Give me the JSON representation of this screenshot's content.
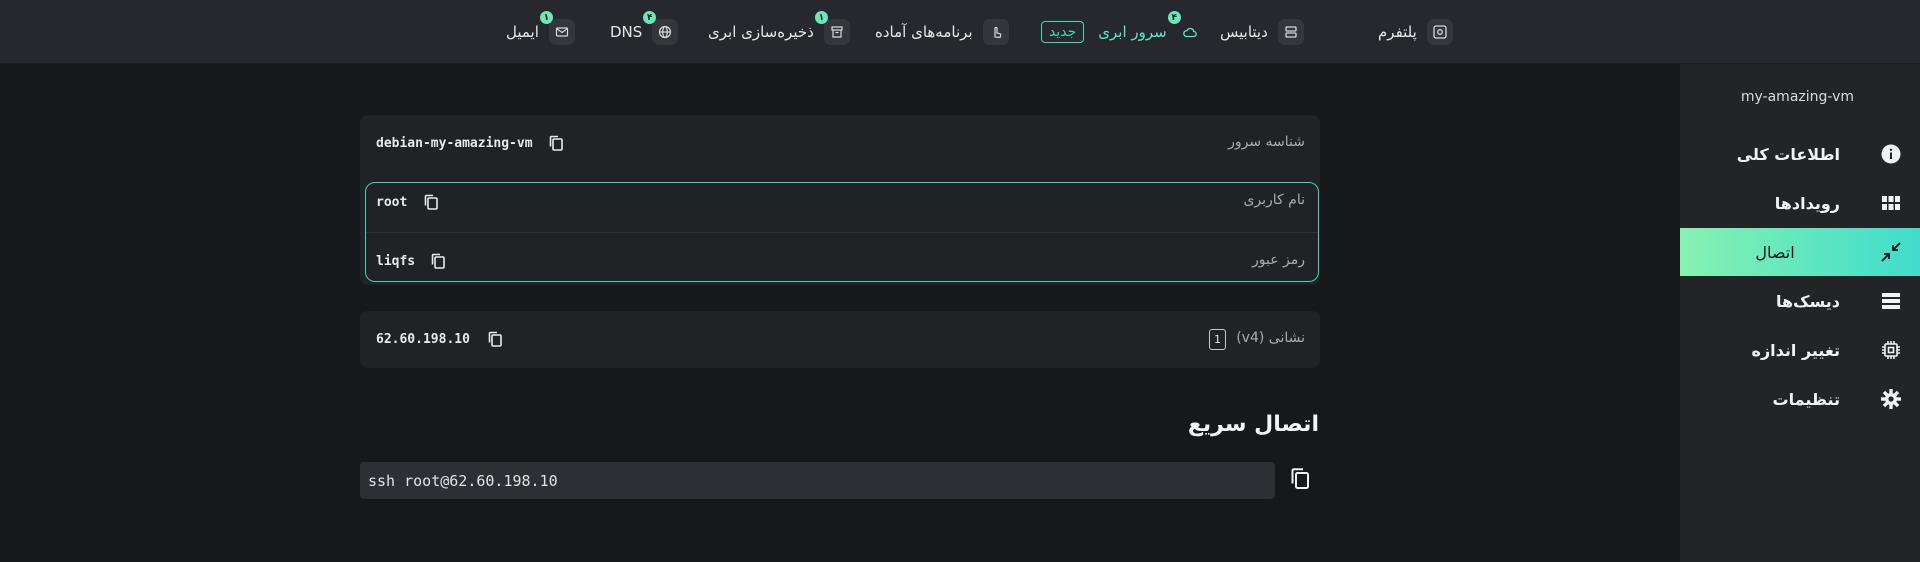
{
  "nav": {
    "items": [
      {
        "label": "پلتفرم",
        "icon": "platform-icon"
      },
      {
        "label": "دیتابیس",
        "icon": "database-icon"
      },
      {
        "label": "سرور ابری",
        "icon": "cloud-icon",
        "badge": "۴",
        "tag": "جدید",
        "active": true
      },
      {
        "label": "برنامه‌های آماده",
        "icon": "hand-pointer-icon"
      },
      {
        "label": "ذخیره‌سازی ابری",
        "icon": "archive-icon",
        "badge": "۱"
      },
      {
        "label": "DNS",
        "icon": "globe-icon",
        "badge": "۴"
      },
      {
        "label": "ایمیل",
        "icon": "mail-icon",
        "badge": "۱"
      }
    ]
  },
  "sidebar": {
    "vm_name": "my-amazing-vm",
    "items": [
      {
        "label": "اطلاعات کلی",
        "icon": "info-icon"
      },
      {
        "label": "رویدادها",
        "icon": "grid-icon"
      },
      {
        "label": "اتصال",
        "icon": "connect-arrows-icon",
        "active": true
      },
      {
        "label": "دیسک‌ها",
        "icon": "list-icon"
      },
      {
        "label": "تغییر اندازه",
        "icon": "chip-icon"
      },
      {
        "label": "تنظیمات",
        "icon": "gear-icon"
      }
    ]
  },
  "server": {
    "id_label": "شناسه سرور",
    "id_value": "debian-my-amazing-vm",
    "username_label": "نام کاربری",
    "username_value": "root",
    "password_label": "رمز عبور",
    "password_value": "liqfs",
    "ip_label": "نشانی (v4)",
    "ip_count": "1",
    "ip_value": "62.60.198.10"
  },
  "quick_connect": {
    "title": "اتصال سریع",
    "command": "ssh root@62.60.198.10"
  },
  "colors": {
    "accent": "#3ddbb0",
    "badge": "#6ee7b7",
    "active_gradient_start": "#86f2b0",
    "active_gradient_end": "#3fdccd"
  }
}
